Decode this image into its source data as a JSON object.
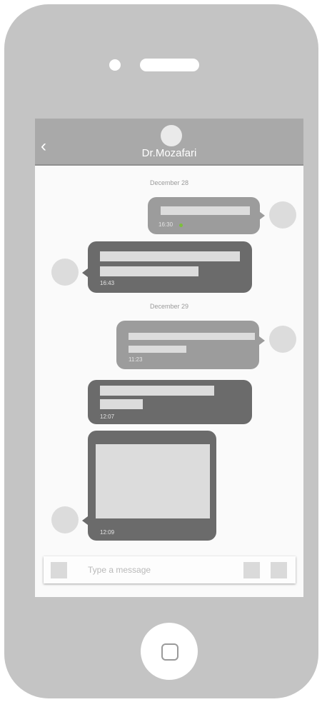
{
  "header": {
    "back_icon": "‹",
    "contact_name": "Dr.Mozafari"
  },
  "messages": {
    "date_1": "December 28",
    "date_2": "December 29",
    "m1_time": "16:30",
    "m2_time": "16:43",
    "m3_time": "11:23",
    "m4_time": "12:07",
    "m5_time": "12:09"
  },
  "composer": {
    "placeholder": "Type a message"
  },
  "colors": {
    "read_tick": "#7cbf3a"
  }
}
